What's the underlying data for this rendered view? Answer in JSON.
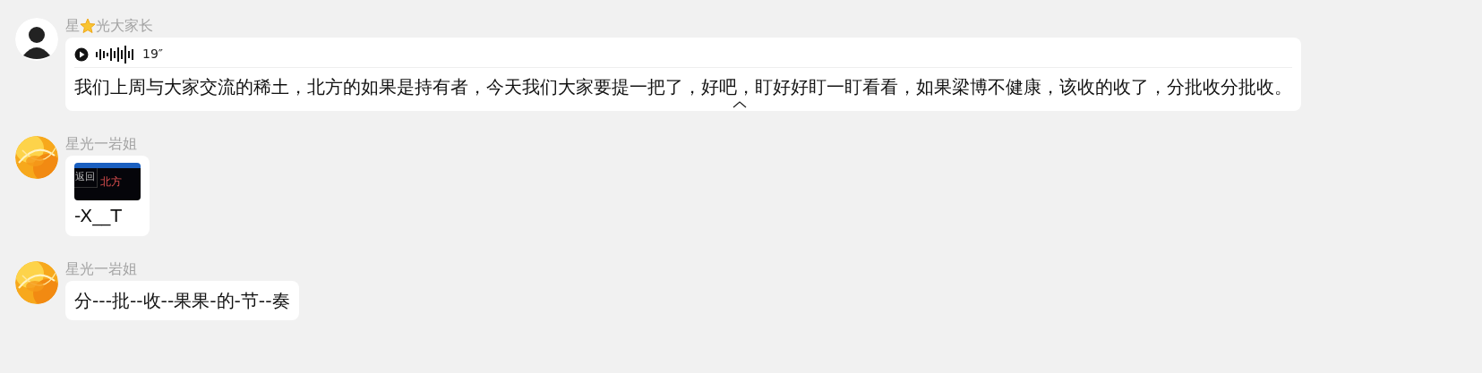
{
  "messages": [
    {
      "avatar": {
        "kind": "silhouette"
      },
      "sender_parts": [
        "星",
        "光大家长"
      ],
      "kind": "voice",
      "duration": "19″",
      "text": "我们上周与大家交流的稀土，北方的如果是持有者，今天我们大家要提一把了，好吧，盯好好盯一盯看看，如果梁博不健康，该收的收了，分批收分批收。",
      "collapsed": false
    },
    {
      "avatar": {
        "kind": "picture"
      },
      "sender_parts": [
        "星光一岩姐"
      ],
      "thumb_texts": [
        "返回",
        "北方"
      ],
      "text": "-X__T"
    },
    {
      "avatar": {
        "kind": "picture"
      },
      "sender_parts": [
        "星光一岩姐"
      ],
      "kind": "text",
      "text": "分---批--收--果果-的-节--奏"
    }
  ]
}
